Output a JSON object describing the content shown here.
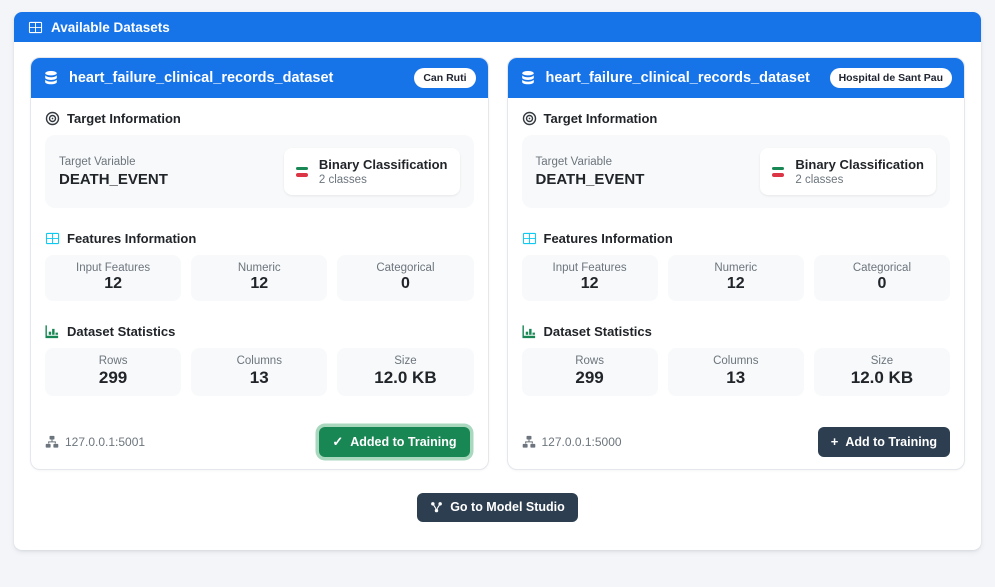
{
  "colors": {
    "primary": "#1673e8",
    "success": "#198754",
    "danger": "#dc3545",
    "info": "#0dcaf0",
    "dark": "#2c3e50",
    "muted": "#6c757d",
    "box": "#f8f9fa",
    "page-bg": "#f3f5f9",
    "success-ring": "#a9d8bf"
  },
  "panel": {
    "title": "Available Datasets"
  },
  "datasets": [
    {
      "name": "heart_failure_clinical_records_dataset",
      "badge": "Can Ruti",
      "target_section": {
        "title": "Target Information",
        "variable_label": "Target Variable",
        "variable_value": "DEATH_EVENT",
        "classification_type": "Binary Classification",
        "classes": "2 classes"
      },
      "features_section": {
        "title": "Features Information",
        "items": [
          {
            "label": "Input Features",
            "value": "12"
          },
          {
            "label": "Numeric",
            "value": "12"
          },
          {
            "label": "Categorical",
            "value": "0"
          }
        ]
      },
      "stats_section": {
        "title": "Dataset Statistics",
        "items": [
          {
            "label": "Rows",
            "value": "299"
          },
          {
            "label": "Columns",
            "value": "13"
          },
          {
            "label": "Size",
            "value": "12.0 KB"
          }
        ]
      },
      "footer": {
        "address": "127.0.0.1:5001",
        "button_label": "Added to Training",
        "button_state": "added"
      }
    },
    {
      "name": "heart_failure_clinical_records_dataset",
      "badge": "Hospital de Sant Pau",
      "target_section": {
        "title": "Target Information",
        "variable_label": "Target Variable",
        "variable_value": "DEATH_EVENT",
        "classification_type": "Binary Classification",
        "classes": "2 classes"
      },
      "features_section": {
        "title": "Features Information",
        "items": [
          {
            "label": "Input Features",
            "value": "12"
          },
          {
            "label": "Numeric",
            "value": "12"
          },
          {
            "label": "Categorical",
            "value": "0"
          }
        ]
      },
      "stats_section": {
        "title": "Dataset Statistics",
        "items": [
          {
            "label": "Rows",
            "value": "299"
          },
          {
            "label": "Columns",
            "value": "13"
          },
          {
            "label": "Size",
            "value": "12.0 KB"
          }
        ]
      },
      "footer": {
        "address": "127.0.0.1:5000",
        "button_label": "Add to Training",
        "button_state": "default"
      }
    }
  ],
  "actions": {
    "model_studio_label": "Go to Model Studio"
  }
}
